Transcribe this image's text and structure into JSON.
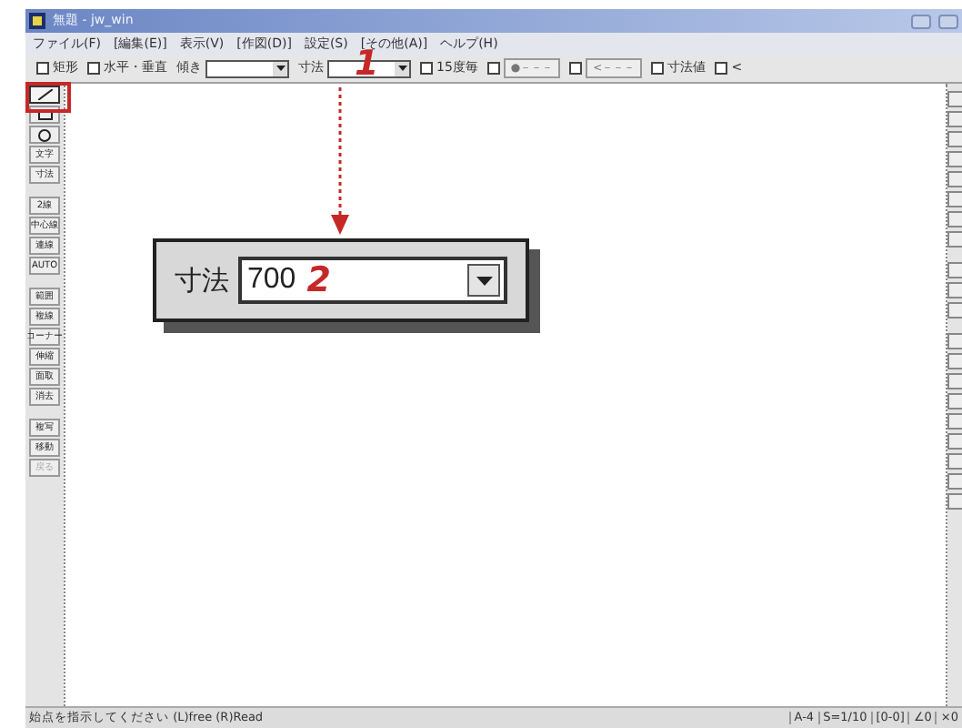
{
  "window": {
    "title": "無題 - jw_win"
  },
  "menu": [
    "ファイル(F)",
    "[編集(E)]",
    "表示(V)",
    "[作図(D)]",
    "設定(S)",
    "[その他(A)]",
    "ヘルプ(H)"
  ],
  "toolbar": [
    {
      "kind": "checkbox",
      "label": "矩形",
      "checked": false
    },
    {
      "kind": "checkbox",
      "label": "水平・垂直",
      "checked": false
    },
    {
      "kind": "combo",
      "label": "傾き"
    },
    {
      "kind": "combo",
      "label": "寸法"
    },
    {
      "kind": "checkbox",
      "label": "15度毎",
      "checked": false
    },
    {
      "kind": "checkbutton",
      "button": "●－－－",
      "checked": false
    },
    {
      "kind": "checkbutton",
      "button": "<－－－",
      "checked": false
    },
    {
      "kind": "checkbox",
      "label": "寸法値",
      "checked": false
    },
    {
      "kind": "checkbox",
      "label": "<",
      "checked": false
    }
  ],
  "tools": [
    {
      "kind": "line",
      "selected": true,
      "disabled": false
    },
    {
      "kind": "rectangle",
      "selected": false,
      "disabled": false
    },
    {
      "kind": "circle",
      "selected": false,
      "disabled": false
    },
    {
      "kind": "text",
      "label": "文字",
      "selected": false,
      "disabled": false
    },
    {
      "kind": "text",
      "label": "寸法",
      "selected": false,
      "disabled": false
    },
    {
      "kind": "gap"
    },
    {
      "kind": "text",
      "label": "2線",
      "selected": false,
      "disabled": false
    },
    {
      "kind": "text",
      "label": "中心線",
      "selected": false,
      "disabled": false
    },
    {
      "kind": "text",
      "label": "連線",
      "selected": false,
      "disabled": false
    },
    {
      "kind": "text",
      "label": "AUTO",
      "selected": false,
      "disabled": false
    },
    {
      "kind": "gap"
    },
    {
      "kind": "text",
      "label": "範囲",
      "selected": false,
      "disabled": false
    },
    {
      "kind": "text",
      "label": "複線",
      "selected": false,
      "disabled": false
    },
    {
      "kind": "text",
      "label": "コーナー",
      "selected": false,
      "disabled": false
    },
    {
      "kind": "text",
      "label": "伸縮",
      "selected": false,
      "disabled": false
    },
    {
      "kind": "text",
      "label": "面取",
      "selected": false,
      "disabled": false
    },
    {
      "kind": "text",
      "label": "消去",
      "selected": false,
      "disabled": false
    },
    {
      "kind": "gap"
    },
    {
      "kind": "text",
      "label": "複写",
      "selected": false,
      "disabled": false
    },
    {
      "kind": "text",
      "label": "移動",
      "selected": false,
      "disabled": false
    },
    {
      "kind": "text",
      "label": "戻る",
      "selected": false,
      "disabled": true
    }
  ],
  "callouts": [
    {
      "number": "1"
    },
    {
      "number": "2"
    }
  ],
  "inset": {
    "label": "寸法",
    "value": "700"
  },
  "status_bar": [
    "始点を指示してください (L)free (R)Read",
    "A-4",
    "S=1/10",
    "[0-0]",
    "∠0",
    "×0"
  ]
}
